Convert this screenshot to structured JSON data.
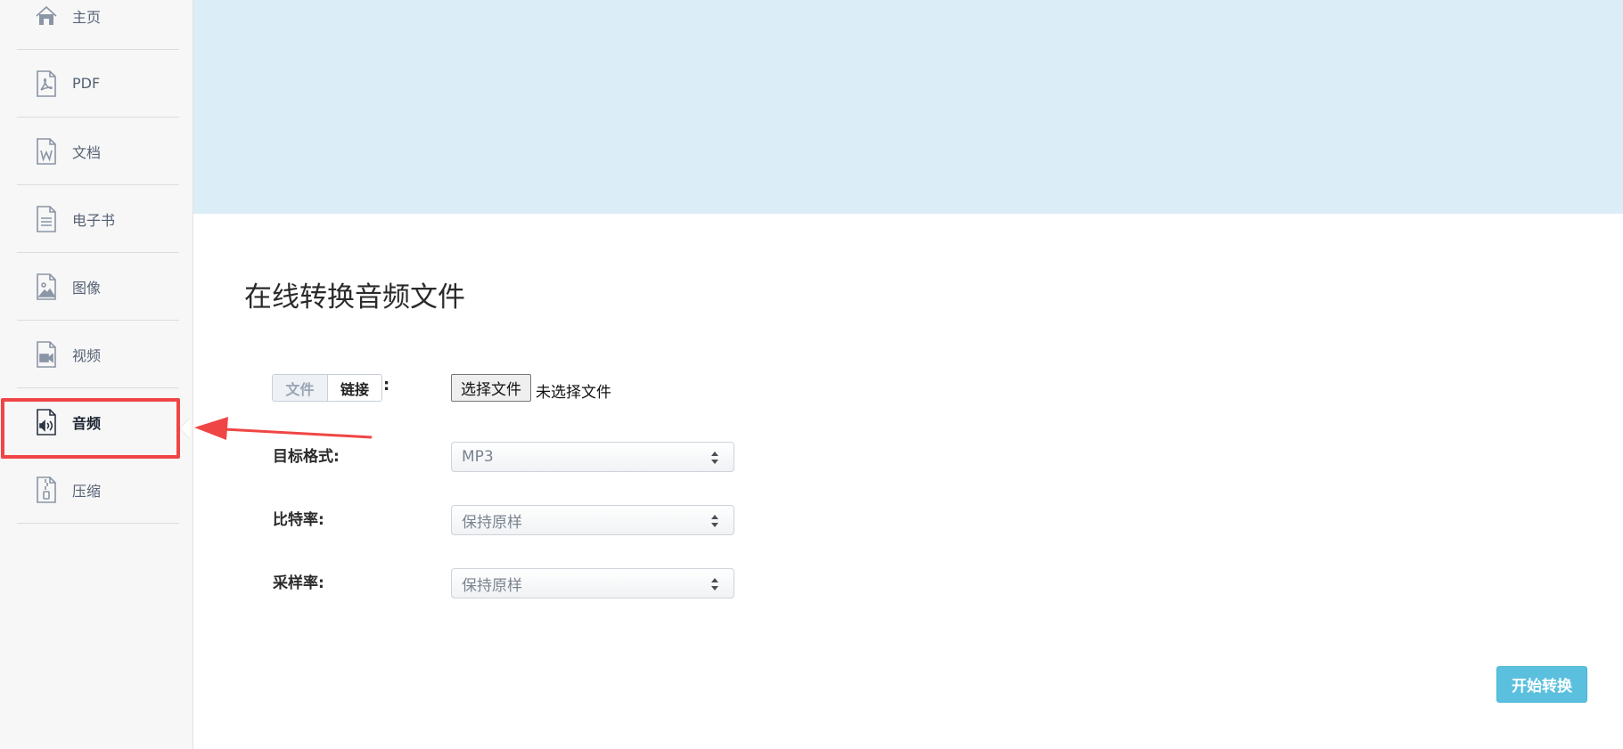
{
  "sidebar": {
    "items": [
      {
        "label": "主页",
        "icon": "home-icon"
      },
      {
        "label": "PDF",
        "icon": "pdf-file-icon"
      },
      {
        "label": "文档",
        "icon": "word-file-icon"
      },
      {
        "label": "电子书",
        "icon": "ebook-file-icon"
      },
      {
        "label": "图像",
        "icon": "image-file-icon"
      },
      {
        "label": "视频",
        "icon": "video-file-icon"
      },
      {
        "label": "音频",
        "icon": "audio-file-icon",
        "active": true
      },
      {
        "label": "压缩",
        "icon": "archive-file-icon"
      }
    ]
  },
  "main": {
    "title": "在线转换音频文件",
    "source_tabs": [
      "文件",
      "链接"
    ],
    "colon": ":",
    "file_button": "选择文件",
    "file_status": "未选择文件",
    "fields": [
      {
        "label": "目标格式:",
        "value": "MP3"
      },
      {
        "label": "比特率:",
        "value": "保持原样"
      },
      {
        "label": "采样率:",
        "value": "保持原样"
      }
    ],
    "start_button": "开始转换"
  },
  "colors": {
    "banner": "#dbeef7",
    "accent_button": "#5bc0de",
    "highlight_red": "#f04545"
  }
}
